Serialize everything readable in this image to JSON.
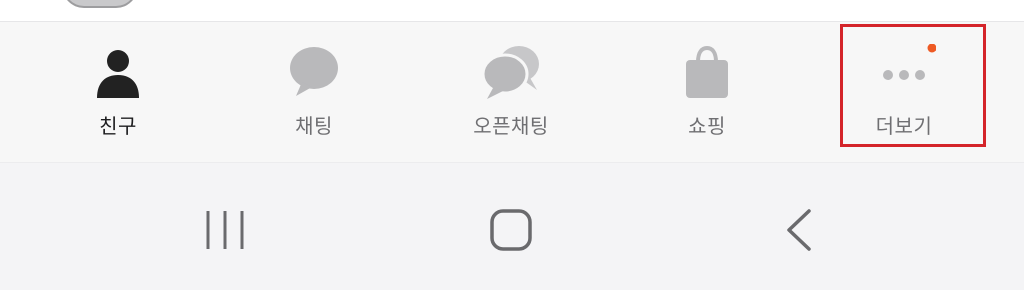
{
  "tabs": [
    {
      "id": "friends",
      "label": "친구",
      "icon": "person-icon",
      "active": true
    },
    {
      "id": "chats",
      "label": "채팅",
      "icon": "chat-bubble-icon",
      "active": false
    },
    {
      "id": "openchat",
      "label": "오픈채팅",
      "icon": "double-chat-bubble-icon",
      "active": false
    },
    {
      "id": "shopping",
      "label": "쇼핑",
      "icon": "shopping-bag-icon",
      "active": false
    },
    {
      "id": "more",
      "label": "더보기",
      "icon": "more-dots-icon",
      "active": false,
      "badge": true
    }
  ],
  "colors": {
    "active_icon": "#222222",
    "inactive_icon": "#b9b9bb",
    "badge": "#ee5a24",
    "highlight": "#d4242a"
  },
  "system_nav": {
    "recents": "recents-icon",
    "home": "home-icon",
    "back": "back-icon"
  }
}
